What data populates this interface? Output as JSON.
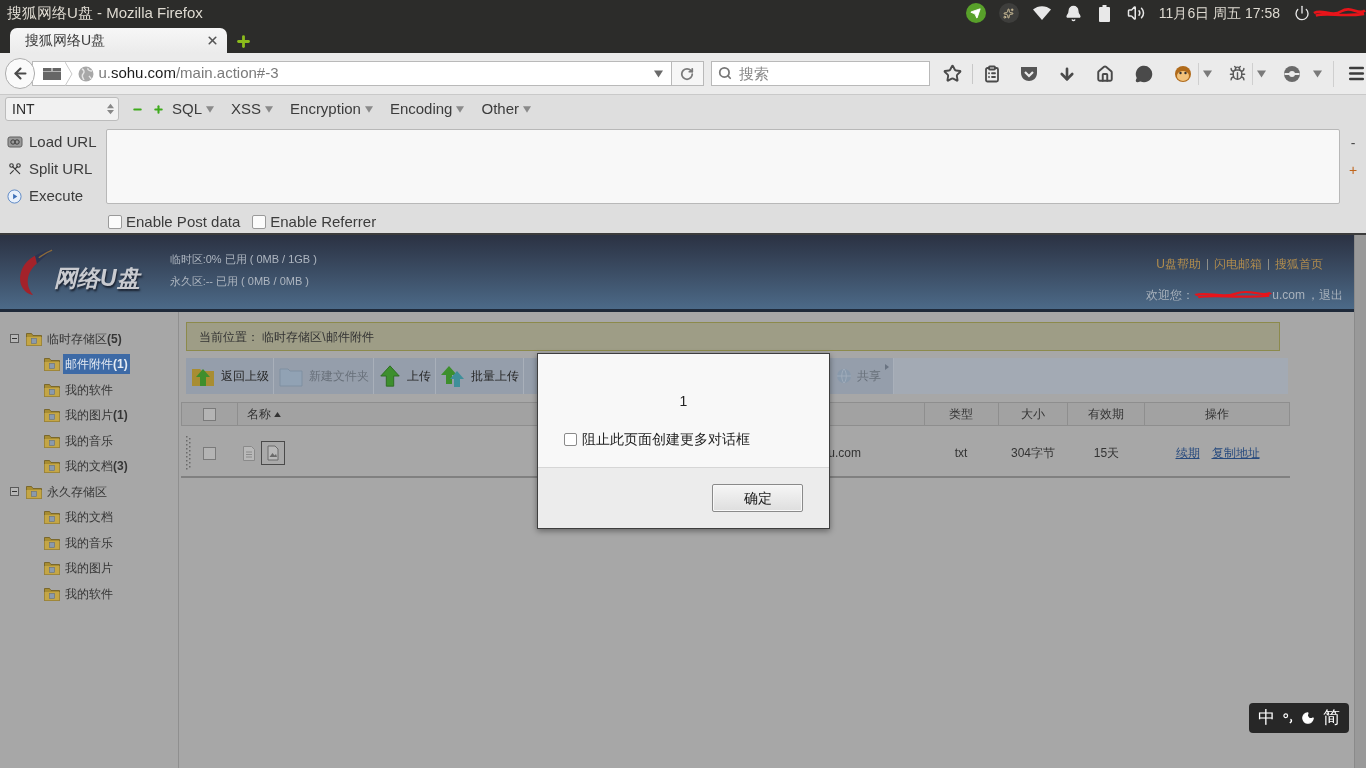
{
  "title_bar": {
    "title": "搜狐网络U盘 - Mozilla Firefox",
    "clock": "11月6日 周五 17:58"
  },
  "tabs": [
    {
      "label": "搜狐网络U盘",
      "selected": true
    }
  ],
  "address_bar": {
    "host_prefix": "u.",
    "host_domain": "sohu.com",
    "path": "/main.action#-3"
  },
  "search": {
    "placeholder": "搜索"
  },
  "hackbar": {
    "select": "INT",
    "menus": [
      "SQL",
      "XSS",
      "Encryption",
      "Encoding",
      "Other"
    ],
    "actions": [
      {
        "label": "Load URL",
        "kind": "load"
      },
      {
        "label": "Split URL",
        "kind": "split"
      },
      {
        "label": "Execute",
        "kind": "execute"
      }
    ],
    "side_buttons": [
      {
        "label": "-",
        "kind": "shrink"
      },
      {
        "label": "+",
        "kind": "grow"
      }
    ],
    "options": [
      {
        "label": "Enable Post data",
        "checked": false
      },
      {
        "label": "Enable Referrer",
        "checked": false
      }
    ]
  },
  "site_header": {
    "logo": "网络U盘",
    "quota": [
      "临时区:0% 已用 ( 0MB / 1GB )",
      "永久区:-- 已用 ( 0MB / 0MB )"
    ],
    "links": [
      "U盘帮助",
      "闪电邮箱",
      "搜狐首页"
    ],
    "welcome": "欢迎您：",
    "email_tail": "u.com",
    "separator": "，",
    "logout": "退出"
  },
  "tree": [
    {
      "label": "临时存储区**(5)**",
      "expanded": true,
      "selected": false,
      "children": [
        {
          "label": "邮件附件**(1)**",
          "selected": true
        },
        {
          "label": "我的软件",
          "selected": false
        },
        {
          "label": "我的图片**(1)**",
          "selected": false
        },
        {
          "label": "我的音乐",
          "selected": false
        },
        {
          "label": "我的文档**(3)**",
          "selected": false
        }
      ]
    },
    {
      "label": "永久存储区",
      "expanded": true,
      "selected": false,
      "children": [
        {
          "label": "我的文档",
          "selected": false
        },
        {
          "label": "我的音乐",
          "selected": false
        },
        {
          "label": "我的图片",
          "selected": false
        },
        {
          "label": "我的软件",
          "selected": false
        }
      ]
    }
  ],
  "breadcrumb": "当前位置： 临时存储区\\邮件附件",
  "toolbar": [
    {
      "label": "返回上级",
      "kind": "back",
      "disabled": false
    },
    {
      "label": "新建文件夹",
      "kind": "new-folder",
      "disabled": true
    },
    {
      "label": "上传",
      "kind": "upload",
      "disabled": false
    },
    {
      "label": "批量上传",
      "kind": "batch-upload",
      "disabled": false
    },
    {
      "label": "共享",
      "kind": "share",
      "disabled": true
    }
  ],
  "table": {
    "select_all": false,
    "columns": [
      {
        "label": "名称",
        "sorted": true
      },
      {
        "label": "类型",
        "sorted": false
      },
      {
        "label": "大小",
        "sorted": false
      },
      {
        "label": "有效期",
        "sorted": false
      },
      {
        "label": "操作",
        "sorted": false
      }
    ],
    "rows": [
      {
        "checked": false,
        "name": "u.com",
        "type": "txt",
        "size": "304字节",
        "expiry": "15天",
        "actions": [
          "续期",
          "复制地址"
        ]
      }
    ]
  },
  "dialog": {
    "message": "1",
    "suppress": {
      "label": "阻止此页面创建更多对话框",
      "checked": false
    },
    "button": "确定"
  },
  "ime": {
    "language": "中",
    "script": "简"
  }
}
